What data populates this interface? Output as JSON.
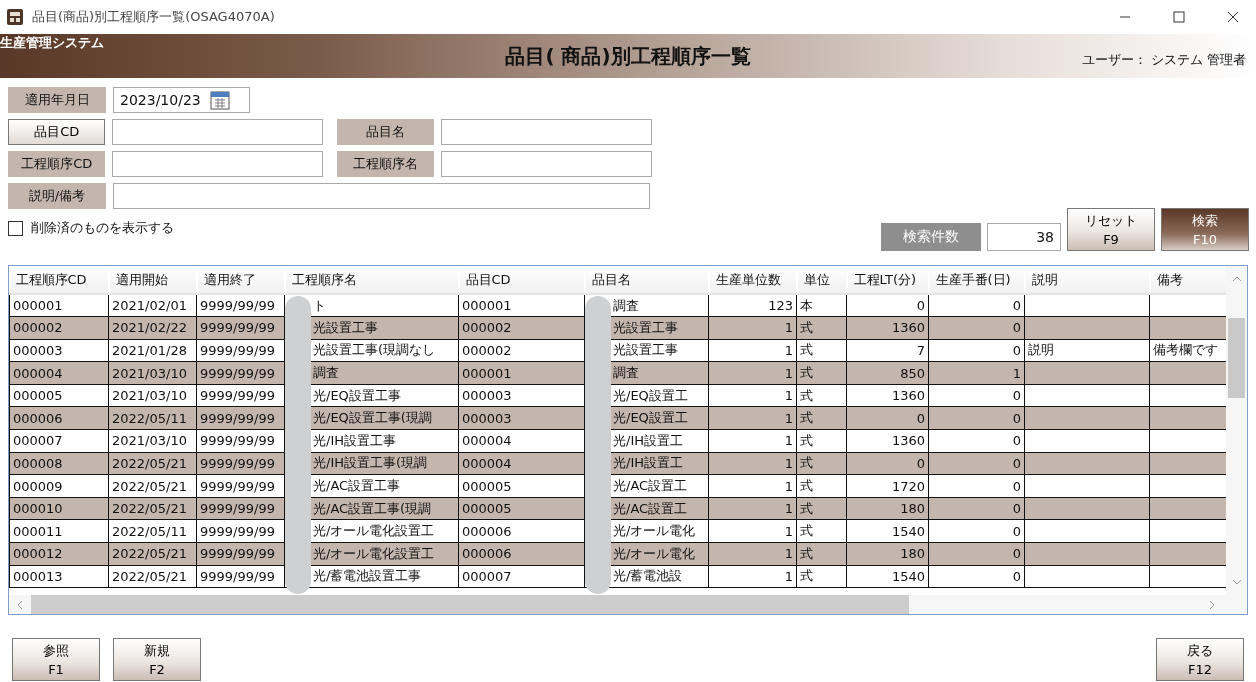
{
  "window": {
    "title": "品目(商品)別工程順序一覧(OSAG4070A)"
  },
  "header": {
    "system": "生産管理システム",
    "title": "品目( 商品)別工程順序一覧",
    "user": "ユーザー： システム 管理者"
  },
  "form": {
    "date": {
      "label": "適用年月日",
      "value": "2023/10/23"
    },
    "rows": [
      {
        "fields": [
          {
            "label": "品目CD",
            "kind": "button"
          },
          {
            "label": "品目名",
            "kind": "label"
          }
        ]
      },
      {
        "fields": [
          {
            "label": "工程順序CD",
            "kind": "label"
          },
          {
            "label": "工程順序名",
            "kind": "label"
          }
        ]
      },
      {
        "fields": [
          {
            "label": "説明/備考",
            "kind": "label",
            "wide": true
          }
        ]
      }
    ],
    "show_deleted": {
      "label": "削除済のものを表示する",
      "checked": false
    }
  },
  "search": {
    "count_label": "検索件数",
    "count": "38",
    "buttons": [
      {
        "label": "リセット",
        "key": "F9",
        "kind": "normal"
      },
      {
        "label": "検索",
        "key": "F10",
        "kind": "primary"
      }
    ]
  },
  "table": {
    "columns": [
      {
        "label": "工程順序CD",
        "kind": "text"
      },
      {
        "label": "適用開始",
        "kind": "text"
      },
      {
        "label": "適用終了",
        "kind": "text"
      },
      {
        "label": "工程順序名",
        "kind": "text"
      },
      {
        "label": "品目CD",
        "kind": "text"
      },
      {
        "label": "品目名",
        "kind": "text"
      },
      {
        "label": "生産単位数",
        "kind": "number"
      },
      {
        "label": "単位",
        "kind": "text"
      },
      {
        "label": "工程LT(分)",
        "kind": "number"
      },
      {
        "label": "生産手番(日)",
        "kind": "number"
      },
      {
        "label": "説明",
        "kind": "text"
      },
      {
        "label": "備考",
        "kind": "text"
      }
    ],
    "rows": [
      [
        "000001",
        "2021/02/01",
        "9999/99/99",
        "ト",
        "000001",
        "調査",
        "123",
        "本",
        "0",
        "0",
        null,
        null
      ],
      [
        "000002",
        "2021/02/22",
        "9999/99/99",
        "光設置工事",
        "000002",
        "光設置工事",
        "1",
        "式",
        "1360",
        "0",
        null,
        null
      ],
      [
        "000003",
        "2021/01/28",
        "9999/99/99",
        "光設置工事(現調なし",
        "000002",
        "光設置工事",
        "1",
        "式",
        "7",
        "0",
        "説明",
        "備考欄です"
      ],
      [
        "000004",
        "2021/03/10",
        "9999/99/99",
        "調査",
        "000001",
        "調査",
        "1",
        "式",
        "850",
        "1",
        null,
        null
      ],
      [
        "000005",
        "2021/03/10",
        "9999/99/99",
        "光/EQ設置工事",
        "000003",
        "光/EQ設置工",
        "1",
        "式",
        "1360",
        "0",
        null,
        null
      ],
      [
        "000006",
        "2022/05/11",
        "9999/99/99",
        "光/EQ設置工事(現調",
        "000003",
        "光/EQ設置工",
        "1",
        "式",
        "0",
        "0",
        null,
        null
      ],
      [
        "000007",
        "2021/03/10",
        "9999/99/99",
        "光/IH設置工事",
        "000004",
        "光/IH設置工",
        "1",
        "式",
        "1360",
        "0",
        null,
        null
      ],
      [
        "000008",
        "2022/05/21",
        "9999/99/99",
        "光/IH設置工事(現調",
        "000004",
        "光/IH設置工",
        "1",
        "式",
        "0",
        "0",
        null,
        null
      ],
      [
        "000009",
        "2022/05/21",
        "9999/99/99",
        "光/AC設置工事",
        "000005",
        "光/AC設置工",
        "1",
        "式",
        "1720",
        "0",
        null,
        null
      ],
      [
        "000010",
        "2022/05/21",
        "9999/99/99",
        "光/AC設置工事(現調",
        "000005",
        "光/AC設置工",
        "1",
        "式",
        "180",
        "0",
        null,
        null
      ],
      [
        "000011",
        "2022/05/11",
        "9999/99/99",
        "光/オール電化設置工",
        "000006",
        "光/オール電化",
        "1",
        "式",
        "1540",
        "0",
        null,
        null
      ],
      [
        "000012",
        "2022/05/21",
        "9999/99/99",
        "光/オール電化設置工",
        "000006",
        "光/オール電化",
        "1",
        "式",
        "180",
        "0",
        null,
        null
      ],
      [
        "000013",
        "2022/05/21",
        "9999/99/99",
        "光/蓄電池設置工事",
        "000007",
        "光/蓄電池設",
        "1",
        "式",
        "1540",
        "0",
        null,
        null
      ]
    ]
  },
  "footer": {
    "left": [
      {
        "label": "参照",
        "key": "F1"
      },
      {
        "label": "新規",
        "key": "F2"
      }
    ],
    "right": [
      {
        "label": "戻る",
        "key": "F12"
      }
    ]
  }
}
